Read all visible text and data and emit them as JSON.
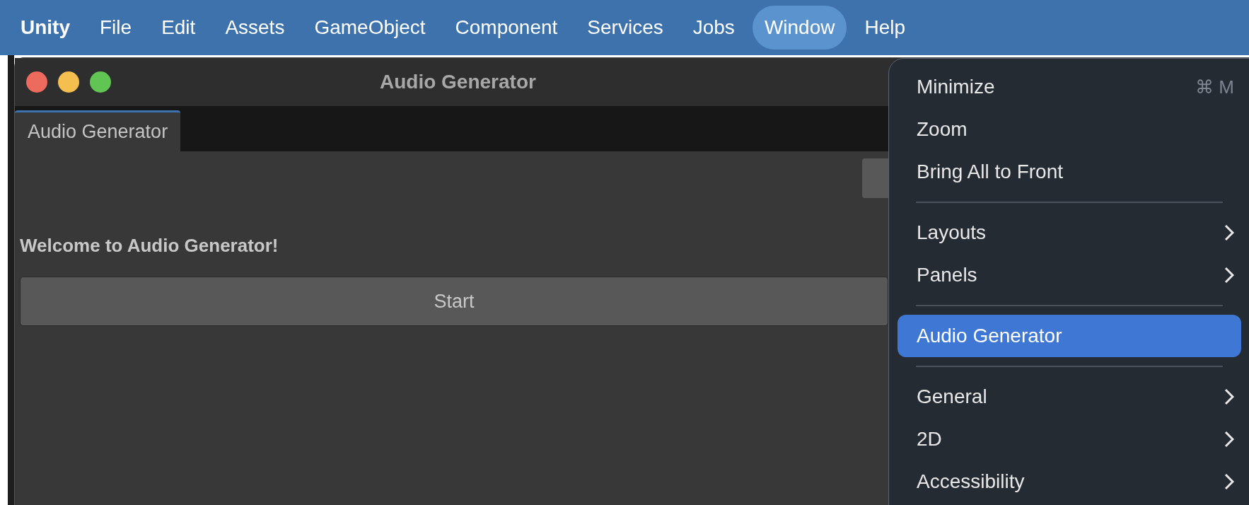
{
  "menu_bar": [
    {
      "label": "Unity",
      "selected": false,
      "bold": true
    },
    {
      "label": "File",
      "selected": false,
      "bold": false
    },
    {
      "label": "Edit",
      "selected": false,
      "bold": false
    },
    {
      "label": "Assets",
      "selected": false,
      "bold": false
    },
    {
      "label": "GameObject",
      "selected": false,
      "bold": false
    },
    {
      "label": "Component",
      "selected": false,
      "bold": false
    },
    {
      "label": "Services",
      "selected": false,
      "bold": false
    },
    {
      "label": "Jobs",
      "selected": false,
      "bold": false
    },
    {
      "label": "Window",
      "selected": true,
      "bold": false
    },
    {
      "label": "Help",
      "selected": false,
      "bold": false
    }
  ],
  "window": {
    "title": "Audio Generator",
    "tabs": [
      {
        "label": "Audio Generator",
        "selected": true
      }
    ],
    "welcome": "Welcome to Audio Generator!",
    "start_button": "Start"
  },
  "window_menu": [
    {
      "kind": "item",
      "label": "Minimize",
      "shortcut": "⌘ M",
      "submenu": false,
      "selected": false
    },
    {
      "kind": "item",
      "label": "Zoom",
      "submenu": false,
      "selected": false
    },
    {
      "kind": "item",
      "label": "Bring All to Front",
      "submenu": false,
      "selected": false
    },
    {
      "kind": "separator"
    },
    {
      "kind": "item",
      "label": "Layouts",
      "submenu": true,
      "selected": false
    },
    {
      "kind": "item",
      "label": "Panels",
      "submenu": true,
      "selected": false
    },
    {
      "kind": "separator"
    },
    {
      "kind": "item",
      "label": "Audio Generator",
      "submenu": false,
      "selected": true
    },
    {
      "kind": "separator"
    },
    {
      "kind": "item",
      "label": "General",
      "submenu": true,
      "selected": false
    },
    {
      "kind": "item",
      "label": "2D",
      "submenu": true,
      "selected": false
    },
    {
      "kind": "item",
      "label": "Accessibility",
      "submenu": true,
      "selected": false
    }
  ]
}
